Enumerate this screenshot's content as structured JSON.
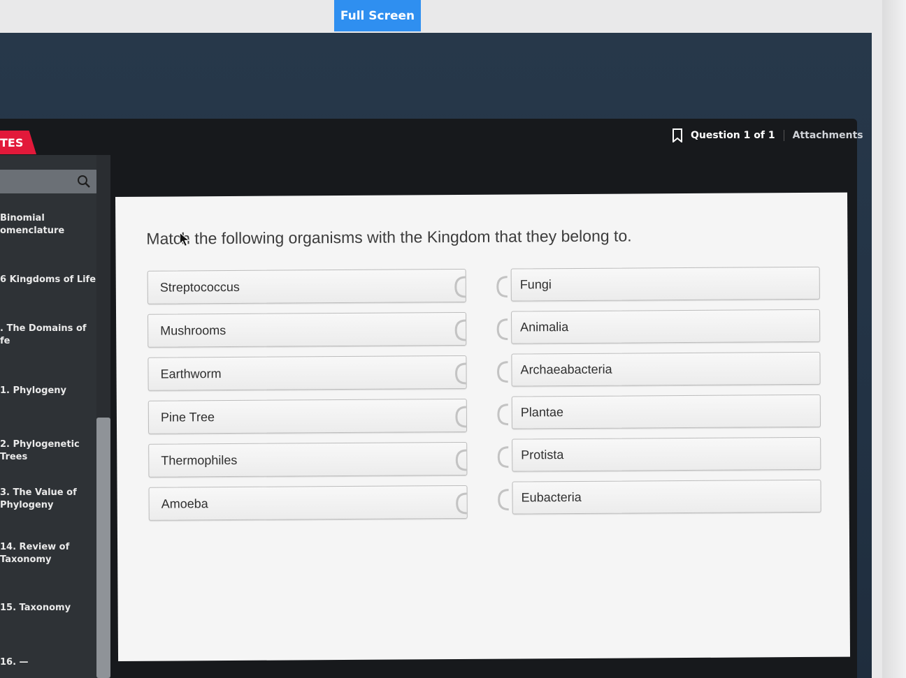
{
  "top_button": {
    "label": "Full Screen"
  },
  "header": {
    "course_tab": "TES",
    "question_counter": "Question 1 of 1",
    "attachments": "Attachments"
  },
  "sidebar": {
    "search_placeholder": "",
    "items": [
      {
        "label": "Binomial\nomenclature"
      },
      {
        "label": "6 Kingdoms of Life"
      },
      {
        "label": ". The Domains of\nfe"
      },
      {
        "label": "1. Phylogeny"
      },
      {
        "label": "2. Phylogenetic Trees"
      },
      {
        "label": "3. The Value of\nPhylogeny"
      },
      {
        "label": "14. Review of\nTaxonomy"
      },
      {
        "label": "15. Taxonomy"
      },
      {
        "label": "16. —"
      }
    ]
  },
  "question": {
    "prompt": "Match the following organisms with the Kingdom that they belong to.",
    "organisms": [
      "Streptococcus",
      "Mushrooms",
      "Earthworm",
      "Pine Tree",
      "Thermophiles",
      "Amoeba"
    ],
    "kingdoms": [
      "Fungi",
      "Animalia",
      "Archaeabacteria",
      "Plantae",
      "Protista",
      "Eubacteria"
    ]
  },
  "colors": {
    "accent_blue": "#2f8ff0",
    "course_red": "#e2193a",
    "frame_navy": "#223244"
  },
  "icons": [
    "bookmark-icon",
    "search-icon",
    "cursor-icon",
    "puzzle-connector-icon"
  ]
}
